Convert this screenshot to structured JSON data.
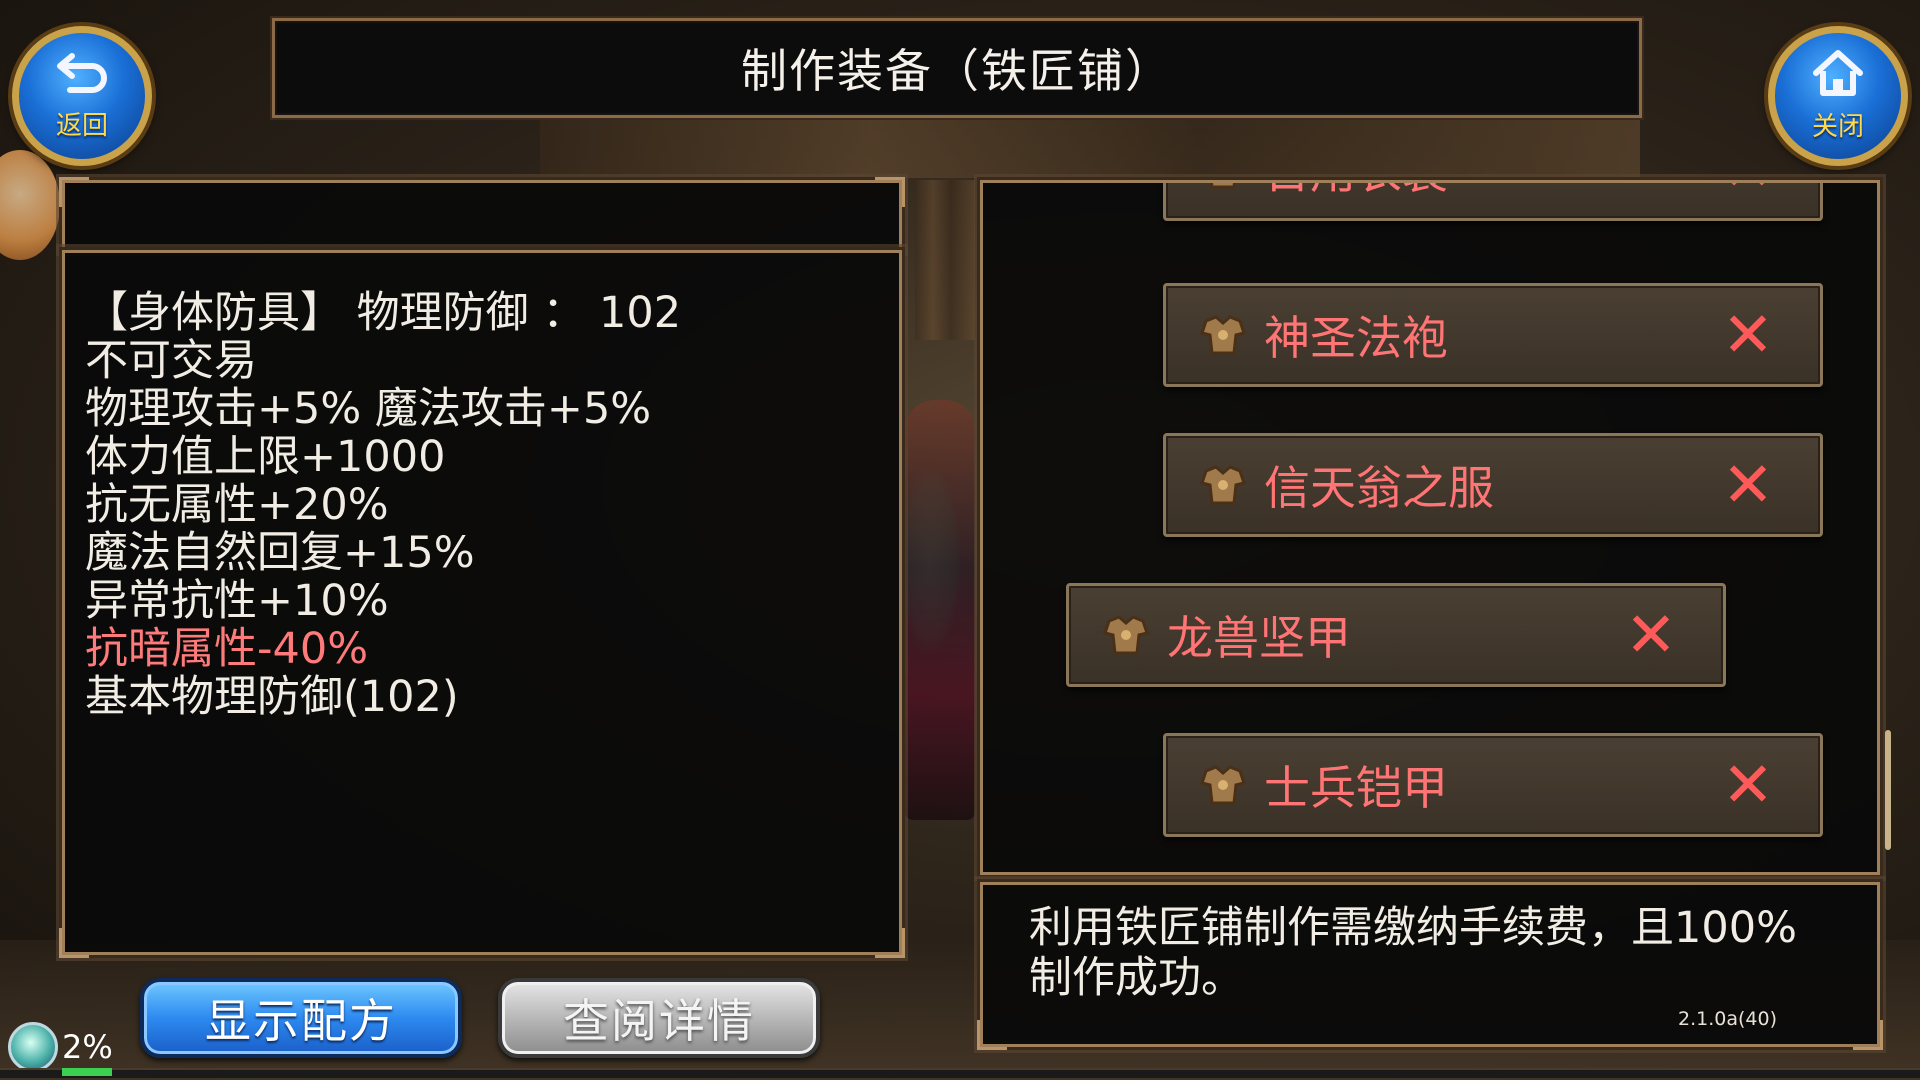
{
  "title": "制作装备（铁匠铺）",
  "nav": {
    "back_label": "返回",
    "close_label": "关闭",
    "back_icon": "return-arrow-icon",
    "close_icon": "home-icon"
  },
  "item_stats": {
    "header_line": "【身体防具】 物理防御 ：  102",
    "lines": [
      {
        "text": "不可交易",
        "negative": false
      },
      {
        "text": "物理攻击+5% 魔法攻击+5%",
        "negative": false
      },
      {
        "text": "体力值上限+1000",
        "negative": false
      },
      {
        "text": "抗无属性+20%",
        "negative": false
      },
      {
        "text": "魔法自然回复+15%",
        "negative": false
      },
      {
        "text": "异常抗性+10%",
        "negative": false
      },
      {
        "text": "抗暗属性-40%",
        "negative": true
      },
      {
        "text": "基本物理防御(102)",
        "negative": false
      }
    ]
  },
  "recipes": [
    {
      "name": "日用衣装",
      "selected": false,
      "status": "✕"
    },
    {
      "name": "神圣法袍",
      "selected": false,
      "status": "✕"
    },
    {
      "name": "信天翁之服",
      "selected": false,
      "status": "✕"
    },
    {
      "name": "龙兽坚甲",
      "selected": true,
      "status": "✕"
    },
    {
      "name": "士兵铠甲",
      "selected": false,
      "status": "✕"
    }
  ],
  "info_text": "利用铁匠铺制作需缴纳手续费，且100%制作成功。",
  "version": "2.1.0a(40)",
  "buttons": {
    "show_recipe": "显示配方",
    "view_detail": "查阅详情"
  },
  "status": {
    "exp_percent_label": "2%",
    "exp_fraction": 0.02
  },
  "colors": {
    "negative_stat": "#ff7a7a",
    "recipe_name": "#ff7474",
    "accent_blue": "#2d8af0",
    "frame_gold": "#c9a24a"
  }
}
